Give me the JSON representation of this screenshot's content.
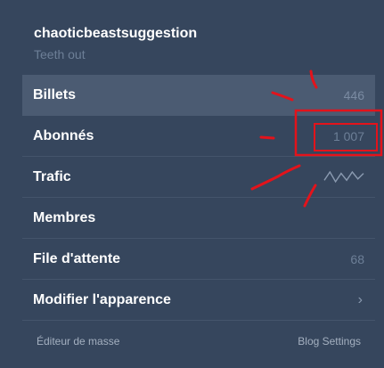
{
  "blog": {
    "name": "chaoticbeastsuggestion",
    "subtitle": "Teeth out"
  },
  "menu": [
    {
      "label": "Billets",
      "count": "446",
      "active": true
    },
    {
      "label": "Abonnés",
      "count": "1 007"
    },
    {
      "label": "Trafic",
      "sparkline": [
        3,
        9,
        2,
        8,
        3,
        9,
        4,
        8
      ]
    },
    {
      "label": "Membres"
    },
    {
      "label": "File d'attente",
      "count": "68"
    },
    {
      "label": "Modifier l'apparence",
      "chevron": "›"
    }
  ],
  "footer": {
    "left": "Éditeur de masse",
    "right": "Blog Settings"
  },
  "colors": {
    "background": "#36465d",
    "active_row": "#4b5b72",
    "annotation": "#e3131b"
  }
}
